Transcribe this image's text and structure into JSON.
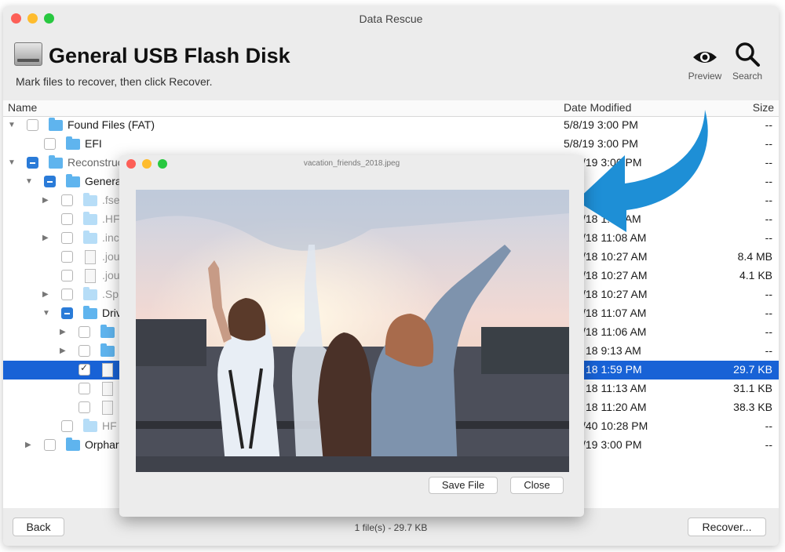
{
  "window": {
    "title": "Data Rescue"
  },
  "header": {
    "disk_name": "General USB Flash Disk",
    "instructions": "Mark files to recover, then click Recover.",
    "preview_label": "Preview",
    "search_label": "Search"
  },
  "columns": {
    "name": "Name",
    "date": "Date Modified",
    "size": "Size"
  },
  "rows": [
    {
      "name": "Found Files (FAT)",
      "date": "5/8/19 3:00 PM",
      "size": "--"
    },
    {
      "name": "EFI",
      "date": "5/8/19 3:00 PM",
      "size": "--"
    },
    {
      "name": "Reconstruc",
      "date": "/19 3:00 PM",
      "size": "--"
    },
    {
      "name": "Genera",
      "date": "",
      "size": "--"
    },
    {
      "name": ".fse",
      "date": "",
      "size": "--"
    },
    {
      "name": ".HF",
      "date": "/18 1:08 AM",
      "size": "--"
    },
    {
      "name": ".inc",
      "date": "/18 11:08 AM",
      "size": "--"
    },
    {
      "name": ".jou",
      "date": "/18 10:27 AM",
      "size": "8.4 MB"
    },
    {
      "name": ".jou",
      "date": "/18 10:27 AM",
      "size": "4.1 KB"
    },
    {
      "name": ".Sp",
      "date": "/18 10:27 AM",
      "size": "--"
    },
    {
      "name": "Driv",
      "date": "/18 11:07 AM",
      "size": "--"
    },
    {
      "name": "",
      "date": "/18 11:06 AM",
      "size": "--"
    },
    {
      "name": "",
      "date": "18 9:13 AM",
      "size": "--"
    },
    {
      "name": "",
      "date": "18 1:59 PM",
      "size": "29.7 KB"
    },
    {
      "name": "",
      "date": "18 11:13 AM",
      "size": "31.1 KB"
    },
    {
      "name": "",
      "date": "18 11:20 AM",
      "size": "38.3 KB"
    },
    {
      "name": "HF",
      "date": "/40 10:28 PM",
      "size": "--"
    },
    {
      "name": "Orphar",
      "date": "/19 3:00 PM",
      "size": "--"
    }
  ],
  "footer": {
    "back_label": "Back",
    "status": "1 file(s) - 29.7 KB",
    "recover_label": "Recover..."
  },
  "preview_window": {
    "filename": "vacation_friends_2018.jpeg",
    "save_label": "Save File",
    "close_label": "Close"
  },
  "colors": {
    "selection": "#1862d6",
    "folder": "#5fb4ee",
    "arrow": "#1e8fd6"
  }
}
